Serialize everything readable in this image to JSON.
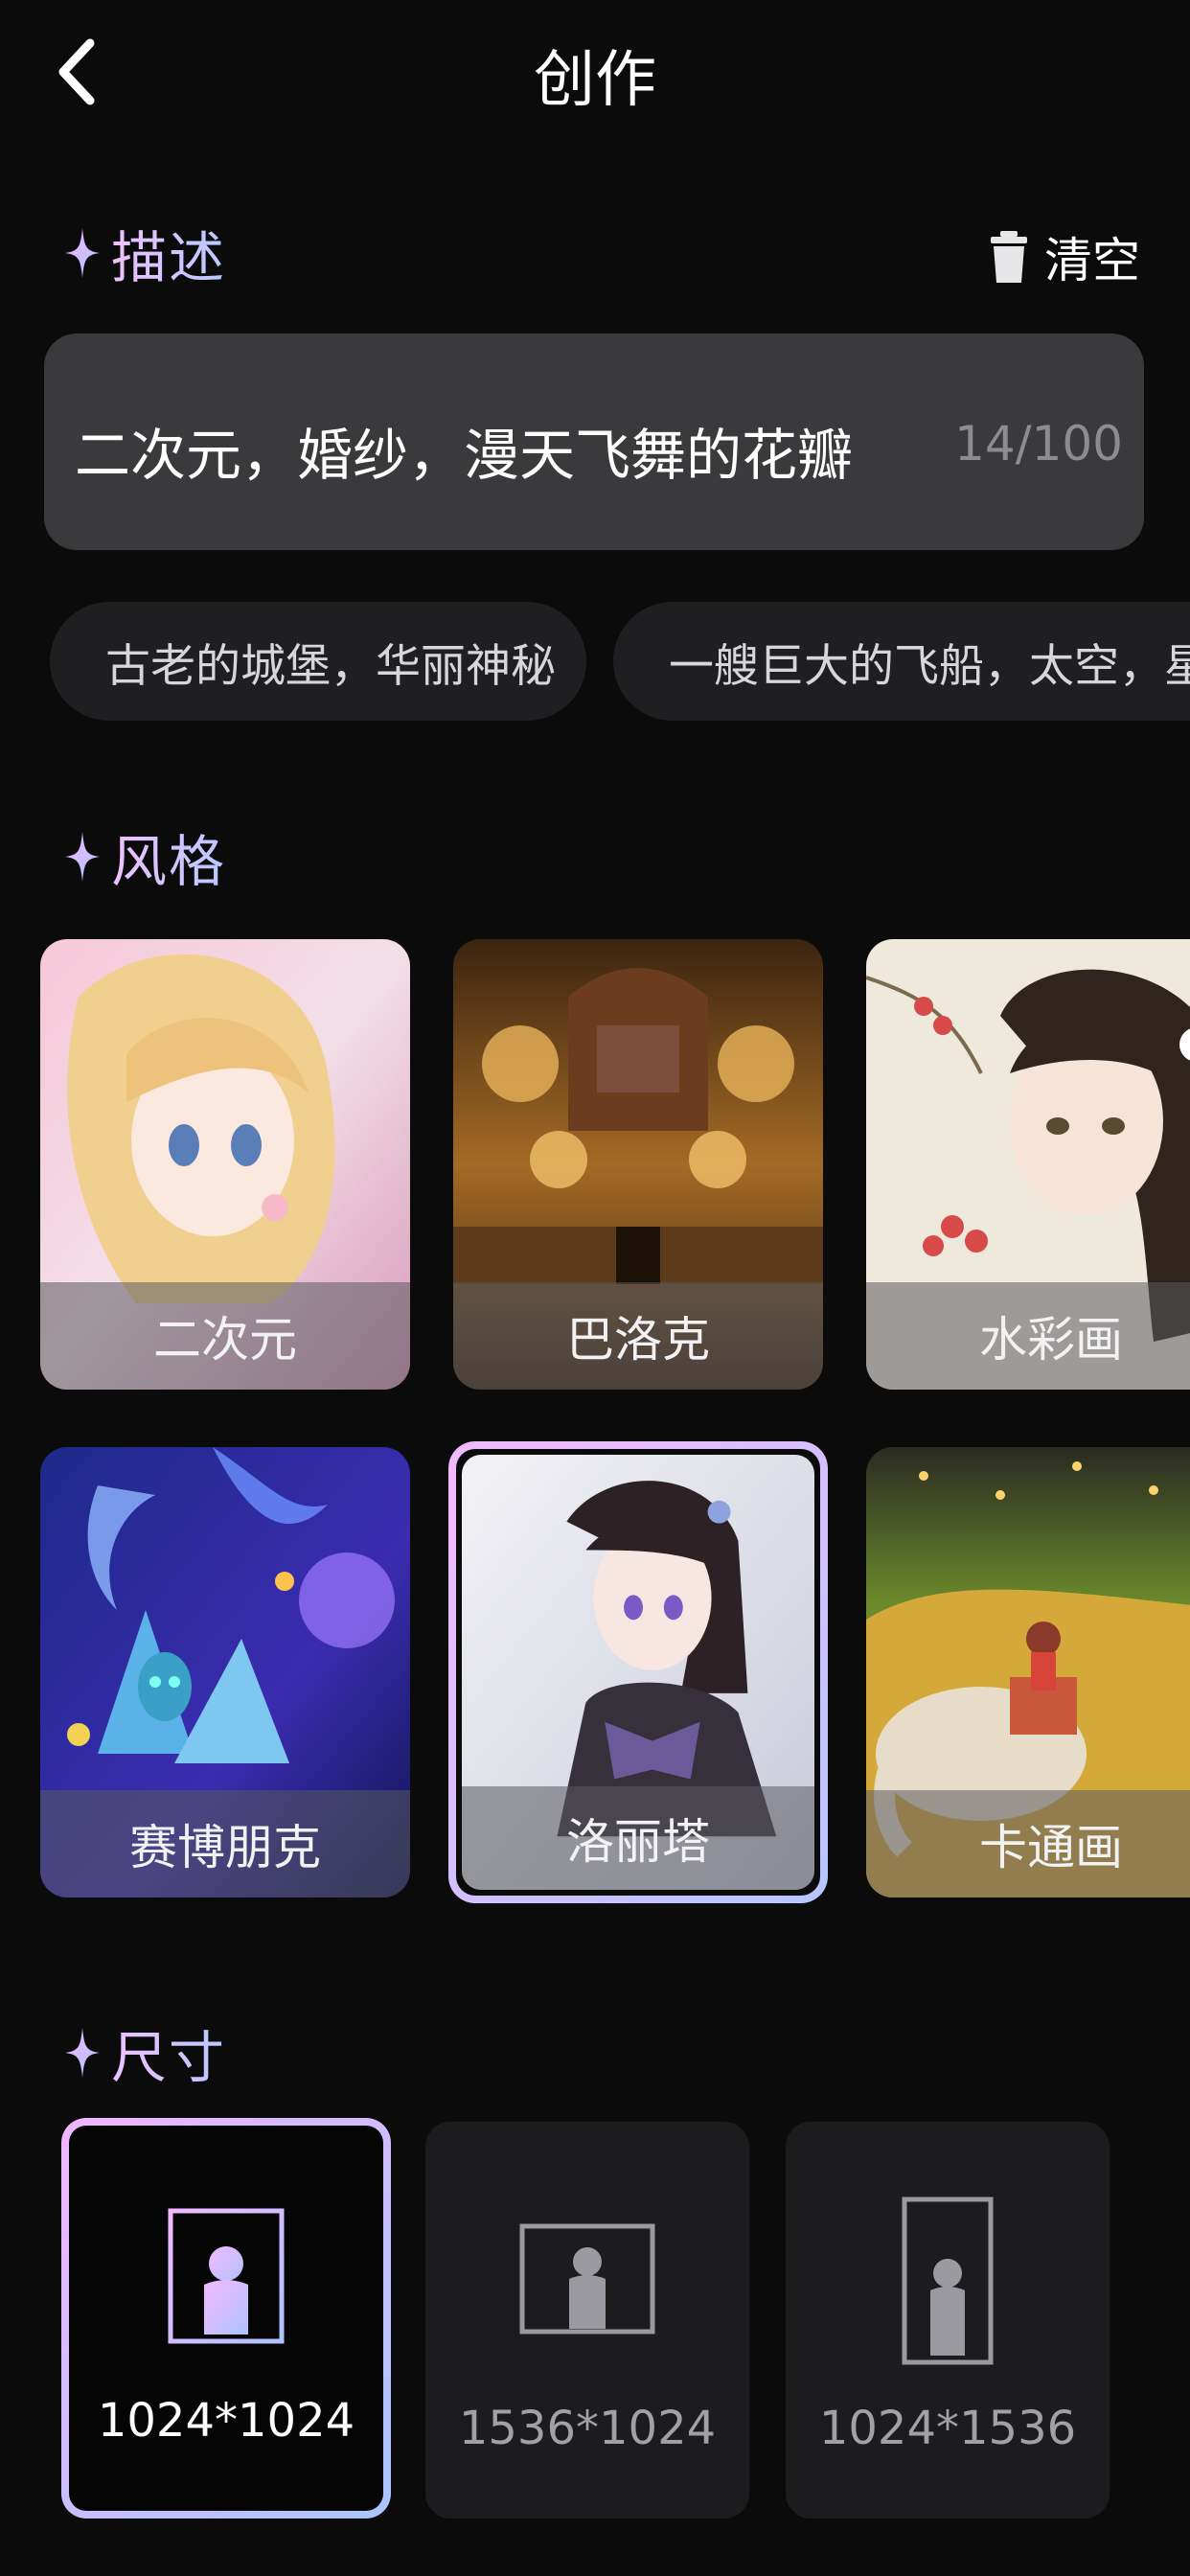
{
  "header": {
    "title": "创作"
  },
  "description": {
    "section_title": "描述",
    "clear_label": "清空",
    "text": "二次元，婚纱，漫天飞舞的花瓣",
    "count": "14/100"
  },
  "suggestions": [
    "古老的城堡，华丽神秘",
    "一艘巨大的飞船，太空，星星"
  ],
  "styles": {
    "section_title": "风格",
    "items": [
      {
        "label": "二次元"
      },
      {
        "label": "巴洛克"
      },
      {
        "label": "水彩画"
      },
      {
        "label": "赛博朋克"
      },
      {
        "label": "洛丽塔",
        "selected": true
      },
      {
        "label": "卡通画"
      }
    ]
  },
  "sizes": {
    "section_title": "尺寸",
    "items": [
      {
        "label": "1024*1024",
        "selected": true
      },
      {
        "label": "1536*1024"
      },
      {
        "label": "1024*1536"
      }
    ]
  },
  "colors": {
    "background": "#0b0b0c",
    "input_bg": "#3a3a3d",
    "chip_bg": "#1f1f21",
    "accent_start": "#efc1ff",
    "accent_end": "#b8c9ff"
  }
}
